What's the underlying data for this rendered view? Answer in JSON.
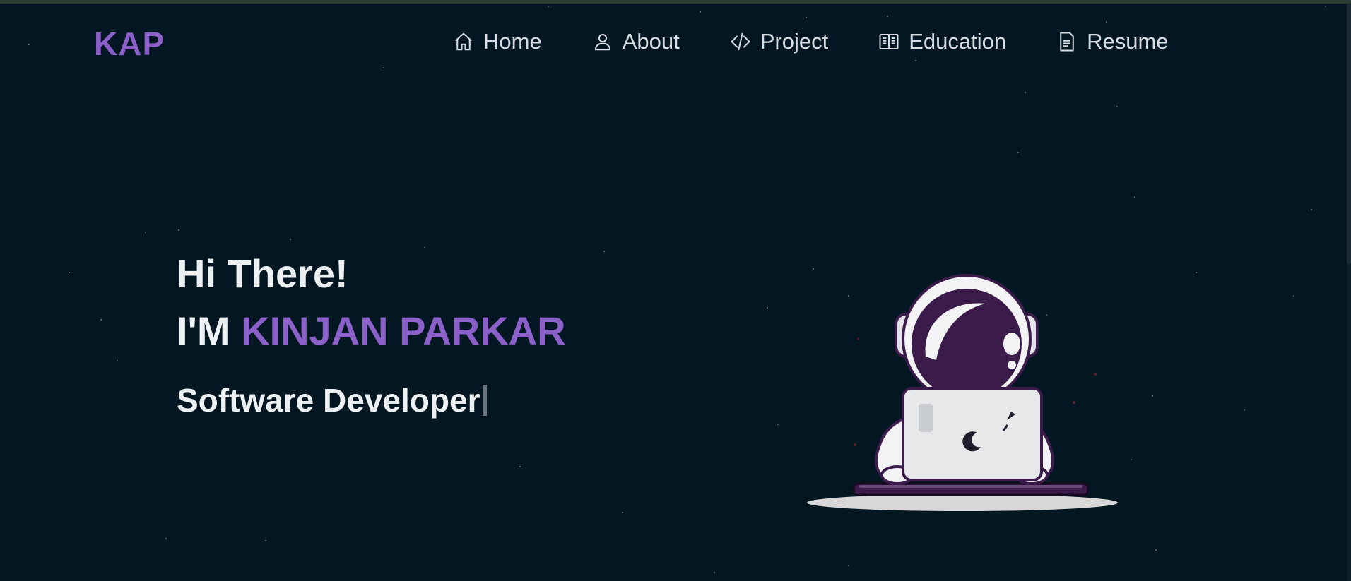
{
  "navbar": {
    "logo": "KAP",
    "links": [
      {
        "label": "Home",
        "icon": "home-icon"
      },
      {
        "label": "About",
        "icon": "user-icon"
      },
      {
        "label": "Project",
        "icon": "code-icon"
      },
      {
        "label": "Education",
        "icon": "book-icon"
      },
      {
        "label": "Resume",
        "icon": "document-icon"
      }
    ]
  },
  "hero": {
    "greeting": "Hi There!",
    "intro_prefix": "I'M ",
    "name": "KINJAN PARKAR",
    "role": "Software Developer"
  },
  "colors": {
    "background": "#031722",
    "accent": "#8b60c9",
    "text": "#eef1f4",
    "nav_text": "#d8dde3"
  }
}
